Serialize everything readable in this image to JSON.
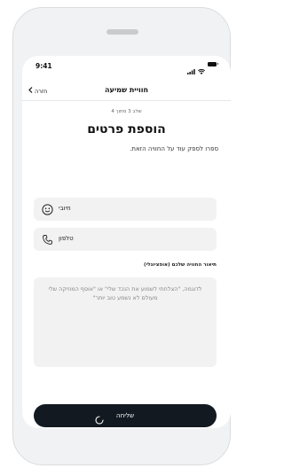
{
  "status": {
    "time": "9:41"
  },
  "nav": {
    "back_label": "חזרה",
    "title": "חוויית שמיעה"
  },
  "step_text": "שלב 3 מתוך 4",
  "heading": "הוספת פרטים",
  "subtitle": "ספרו לספק עוד על החוויה הזאת.",
  "fields": [
    {
      "label": "חיובי",
      "icon": "smiley-icon"
    },
    {
      "label": "טלפון",
      "icon": "phone-icon"
    }
  ],
  "description": {
    "label": "תיאור החוויה שלכם (אופציונלי)",
    "placeholder": "לדוגמה, \"הצלחתי לשמוע את הנכד שלי\" או \"אוסף המוזיקה שלי מעולם לא נשמע טוב יותר\""
  },
  "submit": {
    "label": "שליחה"
  },
  "colors": {
    "button_bg": "#121921",
    "field_bg": "#f2f2f3",
    "text": "#111111"
  }
}
